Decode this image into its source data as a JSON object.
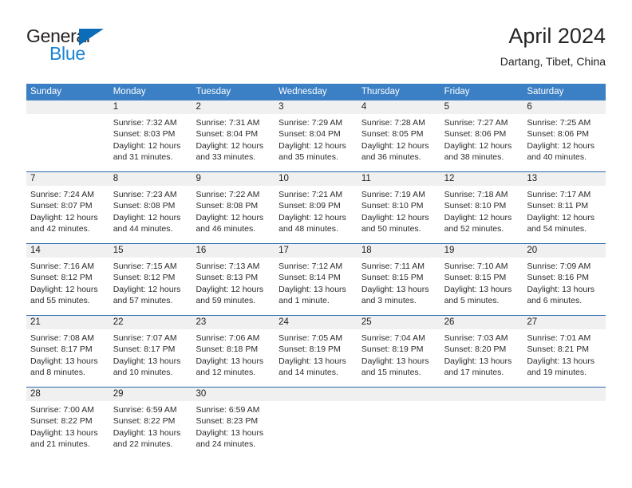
{
  "brand": {
    "name_top": "General",
    "name_bottom": "Blue",
    "color_dark": "#231f20",
    "color_blue": "#1b84d2",
    "triangle_color": "#0b6cb7"
  },
  "header": {
    "title": "April 2024",
    "location": "Dartang, Tibet, China"
  },
  "theme": {
    "header_blue": "#3b7fc4",
    "week_separator_blue": "#2a6aad",
    "number_band_gray": "#f0f0f0"
  },
  "weekdays": [
    "Sunday",
    "Monday",
    "Tuesday",
    "Wednesday",
    "Thursday",
    "Friday",
    "Saturday"
  ],
  "weeks": [
    [
      {
        "day": "",
        "sunrise": "",
        "sunset": "",
        "daylight1": "",
        "daylight2": ""
      },
      {
        "day": "1",
        "sunrise": "Sunrise: 7:32 AM",
        "sunset": "Sunset: 8:03 PM",
        "daylight1": "Daylight: 12 hours",
        "daylight2": "and 31 minutes."
      },
      {
        "day": "2",
        "sunrise": "Sunrise: 7:31 AM",
        "sunset": "Sunset: 8:04 PM",
        "daylight1": "Daylight: 12 hours",
        "daylight2": "and 33 minutes."
      },
      {
        "day": "3",
        "sunrise": "Sunrise: 7:29 AM",
        "sunset": "Sunset: 8:04 PM",
        "daylight1": "Daylight: 12 hours",
        "daylight2": "and 35 minutes."
      },
      {
        "day": "4",
        "sunrise": "Sunrise: 7:28 AM",
        "sunset": "Sunset: 8:05 PM",
        "daylight1": "Daylight: 12 hours",
        "daylight2": "and 36 minutes."
      },
      {
        "day": "5",
        "sunrise": "Sunrise: 7:27 AM",
        "sunset": "Sunset: 8:06 PM",
        "daylight1": "Daylight: 12 hours",
        "daylight2": "and 38 minutes."
      },
      {
        "day": "6",
        "sunrise": "Sunrise: 7:25 AM",
        "sunset": "Sunset: 8:06 PM",
        "daylight1": "Daylight: 12 hours",
        "daylight2": "and 40 minutes."
      }
    ],
    [
      {
        "day": "7",
        "sunrise": "Sunrise: 7:24 AM",
        "sunset": "Sunset: 8:07 PM",
        "daylight1": "Daylight: 12 hours",
        "daylight2": "and 42 minutes."
      },
      {
        "day": "8",
        "sunrise": "Sunrise: 7:23 AM",
        "sunset": "Sunset: 8:08 PM",
        "daylight1": "Daylight: 12 hours",
        "daylight2": "and 44 minutes."
      },
      {
        "day": "9",
        "sunrise": "Sunrise: 7:22 AM",
        "sunset": "Sunset: 8:08 PM",
        "daylight1": "Daylight: 12 hours",
        "daylight2": "and 46 minutes."
      },
      {
        "day": "10",
        "sunrise": "Sunrise: 7:21 AM",
        "sunset": "Sunset: 8:09 PM",
        "daylight1": "Daylight: 12 hours",
        "daylight2": "and 48 minutes."
      },
      {
        "day": "11",
        "sunrise": "Sunrise: 7:19 AM",
        "sunset": "Sunset: 8:10 PM",
        "daylight1": "Daylight: 12 hours",
        "daylight2": "and 50 minutes."
      },
      {
        "day": "12",
        "sunrise": "Sunrise: 7:18 AM",
        "sunset": "Sunset: 8:10 PM",
        "daylight1": "Daylight: 12 hours",
        "daylight2": "and 52 minutes."
      },
      {
        "day": "13",
        "sunrise": "Sunrise: 7:17 AM",
        "sunset": "Sunset: 8:11 PM",
        "daylight1": "Daylight: 12 hours",
        "daylight2": "and 54 minutes."
      }
    ],
    [
      {
        "day": "14",
        "sunrise": "Sunrise: 7:16 AM",
        "sunset": "Sunset: 8:12 PM",
        "daylight1": "Daylight: 12 hours",
        "daylight2": "and 55 minutes."
      },
      {
        "day": "15",
        "sunrise": "Sunrise: 7:15 AM",
        "sunset": "Sunset: 8:12 PM",
        "daylight1": "Daylight: 12 hours",
        "daylight2": "and 57 minutes."
      },
      {
        "day": "16",
        "sunrise": "Sunrise: 7:13 AM",
        "sunset": "Sunset: 8:13 PM",
        "daylight1": "Daylight: 12 hours",
        "daylight2": "and 59 minutes."
      },
      {
        "day": "17",
        "sunrise": "Sunrise: 7:12 AM",
        "sunset": "Sunset: 8:14 PM",
        "daylight1": "Daylight: 13 hours",
        "daylight2": "and 1 minute."
      },
      {
        "day": "18",
        "sunrise": "Sunrise: 7:11 AM",
        "sunset": "Sunset: 8:15 PM",
        "daylight1": "Daylight: 13 hours",
        "daylight2": "and 3 minutes."
      },
      {
        "day": "19",
        "sunrise": "Sunrise: 7:10 AM",
        "sunset": "Sunset: 8:15 PM",
        "daylight1": "Daylight: 13 hours",
        "daylight2": "and 5 minutes."
      },
      {
        "day": "20",
        "sunrise": "Sunrise: 7:09 AM",
        "sunset": "Sunset: 8:16 PM",
        "daylight1": "Daylight: 13 hours",
        "daylight2": "and 6 minutes."
      }
    ],
    [
      {
        "day": "21",
        "sunrise": "Sunrise: 7:08 AM",
        "sunset": "Sunset: 8:17 PM",
        "daylight1": "Daylight: 13 hours",
        "daylight2": "and 8 minutes."
      },
      {
        "day": "22",
        "sunrise": "Sunrise: 7:07 AM",
        "sunset": "Sunset: 8:17 PM",
        "daylight1": "Daylight: 13 hours",
        "daylight2": "and 10 minutes."
      },
      {
        "day": "23",
        "sunrise": "Sunrise: 7:06 AM",
        "sunset": "Sunset: 8:18 PM",
        "daylight1": "Daylight: 13 hours",
        "daylight2": "and 12 minutes."
      },
      {
        "day": "24",
        "sunrise": "Sunrise: 7:05 AM",
        "sunset": "Sunset: 8:19 PM",
        "daylight1": "Daylight: 13 hours",
        "daylight2": "and 14 minutes."
      },
      {
        "day": "25",
        "sunrise": "Sunrise: 7:04 AM",
        "sunset": "Sunset: 8:19 PM",
        "daylight1": "Daylight: 13 hours",
        "daylight2": "and 15 minutes."
      },
      {
        "day": "26",
        "sunrise": "Sunrise: 7:03 AM",
        "sunset": "Sunset: 8:20 PM",
        "daylight1": "Daylight: 13 hours",
        "daylight2": "and 17 minutes."
      },
      {
        "day": "27",
        "sunrise": "Sunrise: 7:01 AM",
        "sunset": "Sunset: 8:21 PM",
        "daylight1": "Daylight: 13 hours",
        "daylight2": "and 19 minutes."
      }
    ],
    [
      {
        "day": "28",
        "sunrise": "Sunrise: 7:00 AM",
        "sunset": "Sunset: 8:22 PM",
        "daylight1": "Daylight: 13 hours",
        "daylight2": "and 21 minutes."
      },
      {
        "day": "29",
        "sunrise": "Sunrise: 6:59 AM",
        "sunset": "Sunset: 8:22 PM",
        "daylight1": "Daylight: 13 hours",
        "daylight2": "and 22 minutes."
      },
      {
        "day": "30",
        "sunrise": "Sunrise: 6:59 AM",
        "sunset": "Sunset: 8:23 PM",
        "daylight1": "Daylight: 13 hours",
        "daylight2": "and 24 minutes."
      },
      {
        "day": "",
        "sunrise": "",
        "sunset": "",
        "daylight1": "",
        "daylight2": ""
      },
      {
        "day": "",
        "sunrise": "",
        "sunset": "",
        "daylight1": "",
        "daylight2": ""
      },
      {
        "day": "",
        "sunrise": "",
        "sunset": "",
        "daylight1": "",
        "daylight2": ""
      },
      {
        "day": "",
        "sunrise": "",
        "sunset": "",
        "daylight1": "",
        "daylight2": ""
      }
    ]
  ]
}
